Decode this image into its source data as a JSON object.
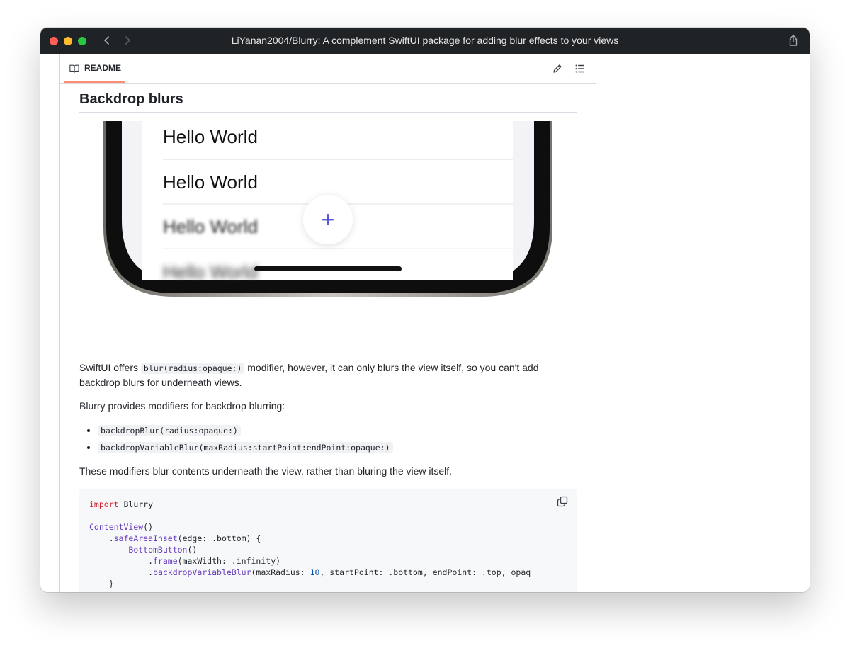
{
  "window": {
    "title": "LiYanan2004/Blurry: A complement SwiftUI package for adding blur effects to your views"
  },
  "readme": {
    "tab_label": "README"
  },
  "content": {
    "heading": "Backdrop blurs",
    "hero": {
      "rows": [
        "Hello World",
        "Hello World",
        "Hello World",
        "Hello World"
      ],
      "fab_symbol": "+"
    },
    "para1": {
      "before": "SwiftUI offers ",
      "code": "blur(radius:opaque:)",
      "after": " modifier, however, it can only blurs the view itself, so you can't add backdrop blurs for underneath views."
    },
    "para2": "Blurry provides modifiers for backdrop blurring:",
    "modifiers": [
      "backdropBlur(radius:opaque:)",
      "backdropVariableBlur(maxRadius:startPoint:endPoint:opaque:)"
    ],
    "para3": "These modifiers blur contents underneath the view, rather than bluring the view itself.",
    "code": {
      "l1_kw": "import",
      "l1_rest": " Blurry",
      "l3_ty": "ContentView",
      "l3_rest": "()",
      "l4_pre": "    .",
      "l4_fn": "safeAreaInset",
      "l4_rest": "(edge: .bottom) {",
      "l5_pre": "        ",
      "l5_ty": "BottomButton",
      "l5_rest": "()",
      "l6_pre": "            .",
      "l6_fn": "frame",
      "l6_rest": "(maxWidth: .infinity)",
      "l7_pre": "            .",
      "l7_fn": "backdropVariableBlur",
      "l7_a": "(maxRadius: ",
      "l7_num": "10",
      "l7_b": ", startPoint: .bottom, endPoint: .top, opaq",
      "l8": "    }"
    }
  },
  "icons": {
    "back": "chevron-left-icon",
    "forward": "chevron-right-icon",
    "share": "share-icon",
    "book": "book-icon",
    "edit": "pencil-icon",
    "toc": "list-icon",
    "copy": "copy-icon"
  },
  "colors": {
    "titlebar": "#202326",
    "tab_underline": "#fd8c73",
    "fab_plus": "#5856d6",
    "code_keyword": "#cf222e",
    "code_type": "#6639ba",
    "code_number": "#0550ae"
  }
}
